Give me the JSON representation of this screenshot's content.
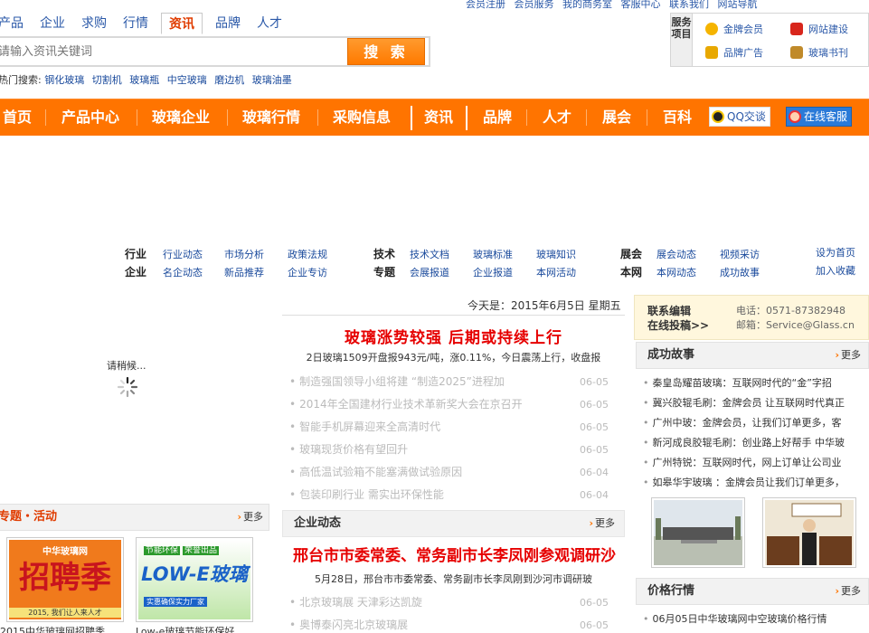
{
  "top_links": [
    "会员注册",
    "会员服务",
    "我的商务室",
    "客服中心",
    "联系我们",
    "网站导航"
  ],
  "search": {
    "tabs": [
      "产品",
      "企业",
      "求购",
      "行情",
      "资讯",
      "品牌",
      "人才"
    ],
    "active_tab": "资讯",
    "placeholder": "请输入资讯关键词",
    "button": "搜 索",
    "hot_label": "热门搜索:",
    "hot_terms": [
      "钢化玻璃",
      "切割机",
      "玻璃瓶",
      "中空玻璃",
      "磨边机",
      "玻璃油墨"
    ]
  },
  "service": {
    "title": "服务项目",
    "items": [
      "金牌会员",
      "网站建设",
      "品牌广告",
      "玻璃书刊"
    ]
  },
  "nav": {
    "items": [
      "首页",
      "产品中心",
      "玻璃企业",
      "玻璃行情",
      "采购信息",
      "资讯",
      "品牌",
      "人才",
      "展会",
      "百科"
    ],
    "qq": "QQ交谈",
    "online": "在线客服"
  },
  "subnav": {
    "row1": {
      "a_label": "行业",
      "a_links": [
        "行业动态",
        "市场分析",
        "政策法规"
      ],
      "b_label": "技术",
      "b_links": [
        "技术文档",
        "玻璃标准",
        "玻璃知识"
      ],
      "c_label": "展会",
      "c_links": [
        "展会动态",
        "视频采访"
      ],
      "d_link": "设为首页"
    },
    "row2": {
      "a_label": "企业",
      "a_links": [
        "名企动态",
        "新品推荐",
        "企业专访"
      ],
      "b_label": "专题",
      "b_links": [
        "会展报道",
        "企业报道",
        "本网活动"
      ],
      "c_label": "本网",
      "c_links": [
        "本网动态",
        "成功故事"
      ],
      "d_link": "加入收藏"
    }
  },
  "loading_text": "请稍候...",
  "today": "今天是：2015年6月5日 星期五",
  "headline": {
    "title": "玻璃涨势较强 后期或持续上行",
    "summary": "2日玻璃1509开盘报943元/吨，涨0.11%，今日震荡上行，收盘报"
  },
  "news": [
    {
      "title": "制造强国领导小组将建 “制造2025”进程加",
      "date": "06-05"
    },
    {
      "title": "2014年全国建材行业技术革新奖大会在京召开",
      "date": "06-05"
    },
    {
      "title": "智能手机屏幕迎来全高清时代",
      "date": "06-05"
    },
    {
      "title": "玻璃现货价格有望回升",
      "date": "06-05"
    },
    {
      "title": "高低温试验箱不能塞满做试验原因",
      "date": "06-04"
    },
    {
      "title": "包装印刷行业 需实出环保性能",
      "date": "06-04"
    }
  ],
  "enterprise": {
    "title": "企业动态",
    "more": "更多",
    "headline": "邢台市市委常委、常务副市长李凤刚参观调研沙",
    "summary": "5月28日，邢台市市委常委、常务副市长李凤刚到沙河市调研玻",
    "news": [
      {
        "title": "北京玻璃展 天津彩达凯旋",
        "date": "06-05"
      },
      {
        "title": "奥博泰闪亮北京玻璃展",
        "date": "06-05"
      }
    ]
  },
  "contact": {
    "label1": "联系编辑",
    "label2": "在线投稿>>",
    "phone": "电话：0571-87382948",
    "email": "邮箱：Service@Glass.cn"
  },
  "success": {
    "title": "成功故事",
    "more": "更多",
    "items": [
      "秦皇岛耀苗玻璃：互联网时代的“金”字招",
      "冀兴胶辊毛刷：金牌会员 让互联网时代真正",
      "广州中玻：金牌会员，让我们订单更多，客",
      "新河成良胶辊毛刷：创业路上好帮手 中华玻",
      "广州特锐：互联网时代，网上订单让公司业",
      "如皋华宇玻璃 ：金牌会员让我们订单更多，"
    ]
  },
  "price": {
    "title": "价格行情",
    "more": "更多",
    "items": [
      "06月05日中华玻璃网中空玻璃价格行情"
    ]
  },
  "topics": {
    "title": "专题・活动",
    "more": "更多",
    "card1_big": "招聘季",
    "card1_top": "中华玻璃网",
    "card1_bottom": "2015, 我们让人来人才",
    "card2_tags": [
      "节能环保",
      "荣誉出品"
    ],
    "card2_big": "LOW-E玻璃",
    "card2_sub": "实惠确保实力厂家",
    "captions": [
      "2015中华玻璃网招聘季",
      "Low-e玻璃节能环保好"
    ]
  }
}
